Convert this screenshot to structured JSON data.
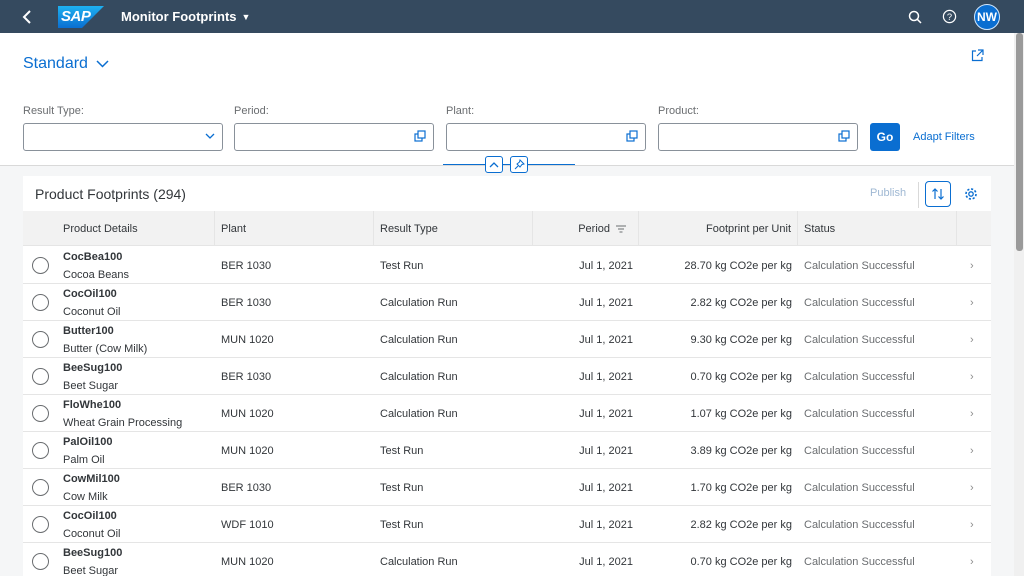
{
  "shell": {
    "app_title": "Monitor Footprints",
    "logo_text": "SAP",
    "avatar_initials": "NW"
  },
  "header": {
    "variant": "Standard",
    "filters": [
      {
        "label": "Result Type:",
        "value": "",
        "icon": "chevron-down-icon"
      },
      {
        "label": "Period:",
        "value": "",
        "icon": "value-help-icon"
      },
      {
        "label": "Plant:",
        "value": "",
        "icon": "value-help-icon"
      },
      {
        "label": "Product:",
        "value": "",
        "icon": "value-help-icon"
      }
    ],
    "go_label": "Go",
    "adapt_label": "Adapt Filters"
  },
  "table": {
    "title": "Product Footprints (294)",
    "publish_label": "Publish",
    "columns": [
      "Product Details",
      "Plant",
      "Result Type",
      "Period",
      "Footprint per Unit",
      "Status"
    ],
    "rows": [
      {
        "id": "CocBea100",
        "desc": "Cocoa Beans",
        "plant": "BER 1030",
        "result": "Test Run",
        "period": "Jul 1, 2021",
        "footprint": "28.70 kg CO2e per kg",
        "status": "Calculation Successful"
      },
      {
        "id": "CocOil100",
        "desc": "Coconut Oil",
        "plant": "BER 1030",
        "result": "Calculation Run",
        "period": "Jul 1, 2021",
        "footprint": "2.82 kg CO2e per kg",
        "status": "Calculation Successful"
      },
      {
        "id": "Butter100",
        "desc": "Butter (Cow Milk)",
        "plant": "MUN 1020",
        "result": "Calculation Run",
        "period": "Jul 1, 2021",
        "footprint": "9.30 kg CO2e per kg",
        "status": "Calculation Successful"
      },
      {
        "id": "BeeSug100",
        "desc": "Beet Sugar",
        "plant": "BER 1030",
        "result": "Calculation Run",
        "period": "Jul 1, 2021",
        "footprint": "0.70 kg CO2e per kg",
        "status": "Calculation Successful"
      },
      {
        "id": "FloWhe100",
        "desc": "Wheat Grain Processing",
        "plant": "MUN 1020",
        "result": "Calculation Run",
        "period": "Jul 1, 2021",
        "footprint": "1.07 kg CO2e per kg",
        "status": "Calculation Successful"
      },
      {
        "id": "PalOil100",
        "desc": "Palm Oil",
        "plant": "MUN 1020",
        "result": "Test Run",
        "period": "Jul 1, 2021",
        "footprint": "3.89 kg CO2e per kg",
        "status": "Calculation Successful"
      },
      {
        "id": "CowMil100",
        "desc": "Cow Milk",
        "plant": "BER 1030",
        "result": "Test Run",
        "period": "Jul 1, 2021",
        "footprint": "1.70 kg CO2e per kg",
        "status": "Calculation Successful"
      },
      {
        "id": "CocOil100",
        "desc": "Coconut Oil",
        "plant": "WDF 1010",
        "result": "Test Run",
        "period": "Jul 1, 2021",
        "footprint": "2.82 kg CO2e per kg",
        "status": "Calculation Successful"
      },
      {
        "id": "BeeSug100",
        "desc": "Beet Sugar",
        "plant": "MUN 1020",
        "result": "Calculation Run",
        "period": "Jul 1, 2021",
        "footprint": "0.70 kg CO2e per kg",
        "status": "Calculation Successful"
      }
    ]
  },
  "colors": {
    "shell_bg": "#354a5f",
    "accent": "#0a6ed1",
    "status_text": "#6a6d70"
  }
}
